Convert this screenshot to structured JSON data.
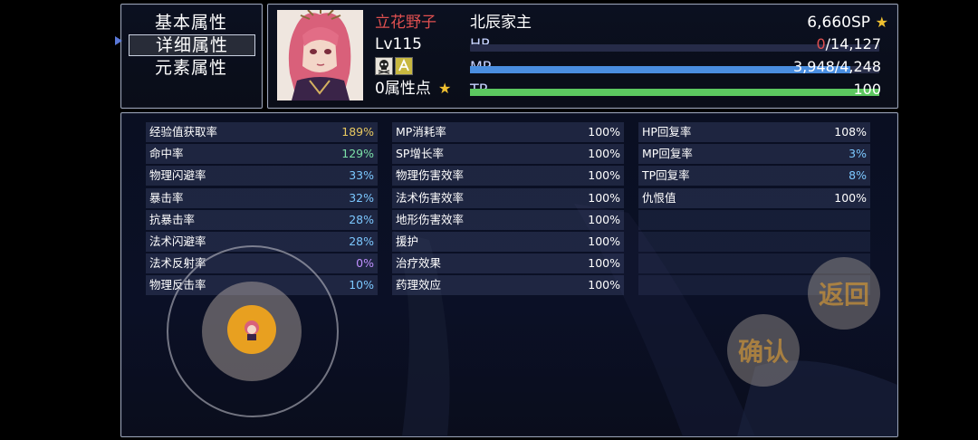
{
  "menu": {
    "items": [
      {
        "label": "基本属性"
      },
      {
        "label": "详细属性"
      },
      {
        "label": "元素属性"
      }
    ],
    "selected_index": 1
  },
  "character": {
    "name": "立花野子",
    "level": "Lv115",
    "attr_points": "0属性点",
    "title": "北辰家主",
    "sp": "6,660SP",
    "hp": {
      "label": "HP",
      "current": "0",
      "max": "/14,127",
      "fraction": 0.0
    },
    "mp": {
      "label": "MP",
      "value": "3,948/4,248",
      "fraction": 0.93
    },
    "tp": {
      "label": "TP",
      "value": "100",
      "fraction": 1.0
    }
  },
  "stats": {
    "col1": [
      {
        "label": "经验值获取率",
        "value": "189%",
        "color": "#e8c860"
      },
      {
        "label": "命中率",
        "value": "129%",
        "color": "#7ce0a8"
      },
      {
        "label": "物理闪避率",
        "value": "33%",
        "color": "#7cc8ff"
      },
      {
        "label": "暴击率",
        "value": "32%",
        "color": "#7cc8ff"
      },
      {
        "label": "抗暴击率",
        "value": "28%",
        "color": "#7cc8ff"
      },
      {
        "label": "法术闪避率",
        "value": "28%",
        "color": "#7cc8ff"
      },
      {
        "label": "法术反射率",
        "value": "0%",
        "color": "#c090ff"
      },
      {
        "label": "物理反击率",
        "value": "10%",
        "color": "#7cc8ff"
      }
    ],
    "col2": [
      {
        "label": "MP消耗率",
        "value": "100%",
        "color": "#ffffff"
      },
      {
        "label": "SP增长率",
        "value": "100%",
        "color": "#ffffff"
      },
      {
        "label": "物理伤害效率",
        "value": "100%",
        "color": "#ffffff"
      },
      {
        "label": "法术伤害效率",
        "value": "100%",
        "color": "#ffffff"
      },
      {
        "label": "地形伤害效率",
        "value": "100%",
        "color": "#ffffff"
      },
      {
        "label": "援护",
        "value": "100%",
        "color": "#ffffff"
      },
      {
        "label": "治疗效果",
        "value": "100%",
        "color": "#ffffff"
      },
      {
        "label": "药理效应",
        "value": "100%",
        "color": "#ffffff"
      }
    ],
    "col3": [
      {
        "label": "HP回复率",
        "value": "108%",
        "color": "#ffffff"
      },
      {
        "label": "MP回复率",
        "value": "3%",
        "color": "#7cc8ff"
      },
      {
        "label": "TP回复率",
        "value": "8%",
        "color": "#7cc8ff"
      },
      {
        "label": "仇恨值",
        "value": "100%",
        "color": "#ffffff"
      },
      {
        "label": "",
        "value": "",
        "color": "#ffffff"
      },
      {
        "label": "",
        "value": "",
        "color": "#ffffff"
      },
      {
        "label": "",
        "value": "",
        "color": "#ffffff"
      },
      {
        "label": "",
        "value": "",
        "color": "#ffffff"
      }
    ]
  },
  "buttons": {
    "back": "返回",
    "confirm": "确认"
  },
  "colors": {
    "name": "#e05050",
    "hp_current": "#e05050",
    "mp_fill": "#4a8ee0",
    "tp_fill": "#5cc860",
    "hp_track": "#262b48"
  }
}
